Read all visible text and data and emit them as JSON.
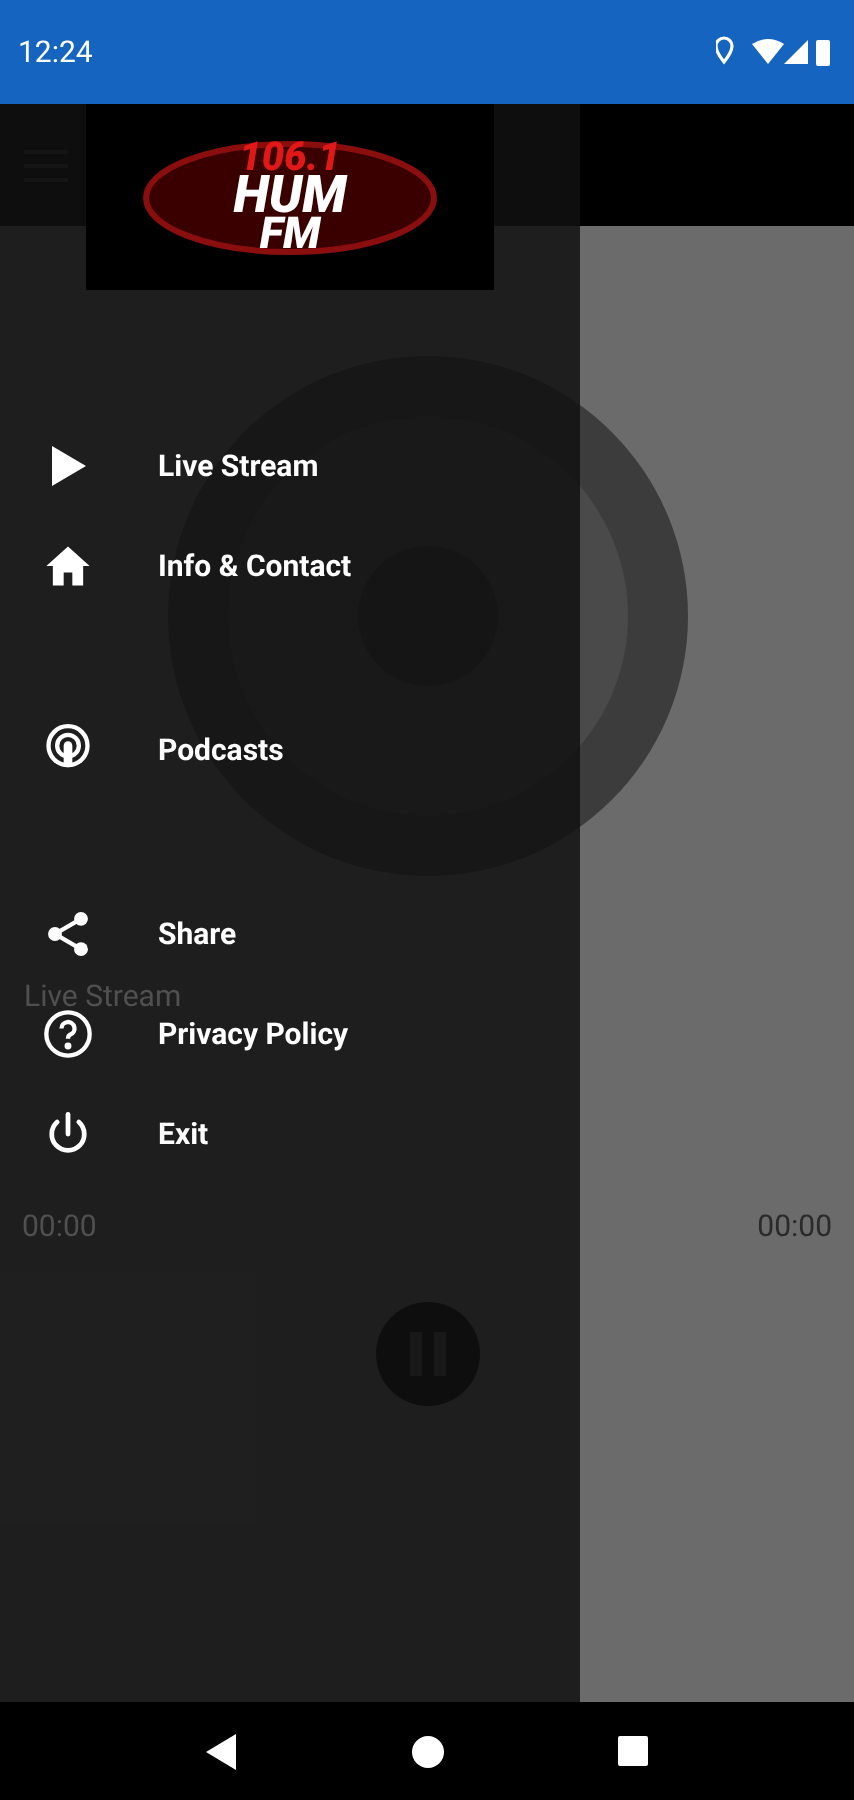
{
  "status_bar": {
    "time": "12:24"
  },
  "player": {
    "title": "Live Stream",
    "elapsed": "00:00",
    "duration": "00:00"
  },
  "drawer": {
    "logo": {
      "line_1": "106.1",
      "line_2": "HUM",
      "line_3": "FM"
    },
    "sections": [
      {
        "items": [
          {
            "label": "Live Stream"
          },
          {
            "label": "Info & Contact"
          }
        ]
      },
      {
        "items": [
          {
            "label": "Podcasts"
          }
        ]
      },
      {
        "items": [
          {
            "label": "Share"
          },
          {
            "label": "Privacy Policy"
          },
          {
            "label": "Exit"
          }
        ]
      }
    ]
  }
}
